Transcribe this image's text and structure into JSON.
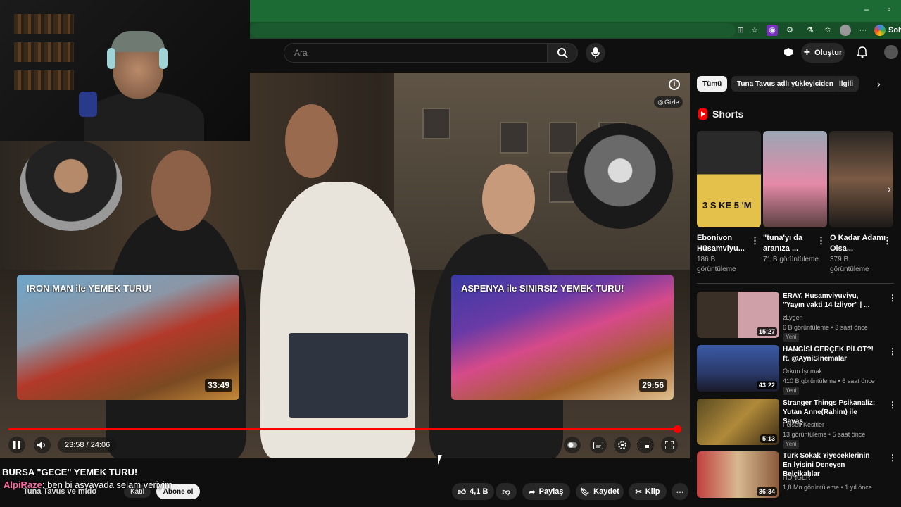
{
  "browser": {
    "sohbet_label": "Soh"
  },
  "header": {
    "search_placeholder": "Ara",
    "create_label": "Oluştur"
  },
  "player": {
    "time_current": "23:58",
    "time_total": "24:06",
    "time_display": "23:58 / 24:06",
    "progress": 0.994,
    "hide_label": "Gizle",
    "info_label": "i"
  },
  "end_cards": [
    {
      "title": "IRON MAN ile YEMEK TURU!",
      "duration": "33:49"
    },
    {
      "title": "ASPENYA ile SINIRSIZ YEMEK TURU!",
      "duration": "29:56"
    }
  ],
  "video": {
    "title": "BURSA \"GECE\" YEMEK TURU!",
    "channel": "Tuna Tavus ve mido",
    "join_label": "Katıl",
    "subscribe_label": "Abone ol",
    "likes": "4,1 B",
    "share_label": "Paylaş",
    "save_label": "Kaydet",
    "clip_label": "Klip"
  },
  "chat_overlay": {
    "user": "AlpiRaze",
    "message": ": ben bi asyayada selam veriyim"
  },
  "chips": [
    "Tümü",
    "Tuna Tavus adlı yükleyiciden",
    "İlgili"
  ],
  "shorts": {
    "heading": "Shorts",
    "items": [
      {
        "title": "Ebonivon Hüsamviyu...",
        "views": "186 B görüntüleme",
        "overlay": "3 S KE 5 'M"
      },
      {
        "title": "\"tuna'yı da aranıza ...",
        "views": "71 B görüntüleme",
        "overlay": ""
      },
      {
        "title": "O Kadar Adamı Olsa...",
        "views": "379 B görüntüleme",
        "overlay": ""
      }
    ]
  },
  "recommendations": [
    {
      "title": "ERAY, Husamviyuviyu, \"Yayın vakti 14 İzliyor\" | ...",
      "channel": "zLygen",
      "meta": "6 B görüntüleme • 3 saat önce",
      "badge": "Yeni",
      "duration": "15:27"
    },
    {
      "title": "HANGİSİ GERÇEK PİLOT?! ft. @AyniSinemalar",
      "channel": "Orkun Işıtmak",
      "meta": "410 B görüntüleme • 6 saat önce",
      "badge": "Yeni",
      "duration": "43:22"
    },
    {
      "title": "Stranger Things Psikanaliz: Yutan Anne(Rahim) ile Savaş",
      "channel": "Felsefi Kesitler",
      "meta": "13 görüntüleme • 5 saat önce",
      "badge": "Yeni",
      "duration": "5:13"
    },
    {
      "title": "Türk Sokak Yiyeceklerinin En İyisini Deneyen Belçikalılar",
      "channel": "HONGER",
      "meta": "1,8 Mn görüntüleme • 1 yıl önce",
      "badge": "",
      "duration": "36:34"
    }
  ],
  "colors": {
    "titlebar": "#1d6b34",
    "youtube_red": "#ff0000",
    "background": "#0f0f0f",
    "chat_user": "#ff6aa2"
  }
}
